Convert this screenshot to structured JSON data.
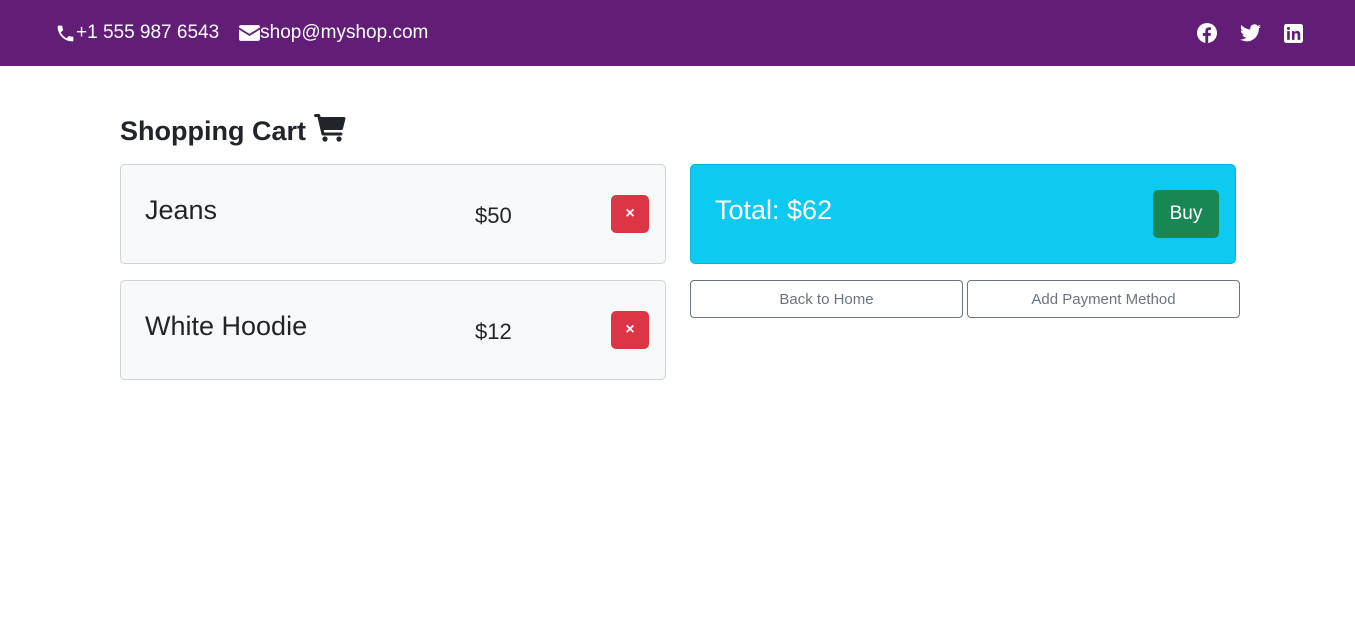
{
  "topbar": {
    "phone": "+1 555 987 6543",
    "email": "shop@myshop.com",
    "social": [
      "facebook-icon",
      "twitter-icon",
      "linkedin-icon"
    ],
    "bg_color": "#621e77"
  },
  "page": {
    "title": "Shopping Cart"
  },
  "cart": {
    "items": [
      {
        "name": "Jeans",
        "price": "$50",
        "remove_label": "×"
      },
      {
        "name": "White Hoodie",
        "price": "$12",
        "remove_label": "×"
      }
    ]
  },
  "summary": {
    "total_label": "Total: $62",
    "buy_label": "Buy",
    "back_label": "Back to Home",
    "payment_label": "Add Payment Method"
  },
  "colors": {
    "danger": "#dc3545",
    "info": "#0dcaf0",
    "success": "#198754",
    "secondary": "#6c757d"
  }
}
